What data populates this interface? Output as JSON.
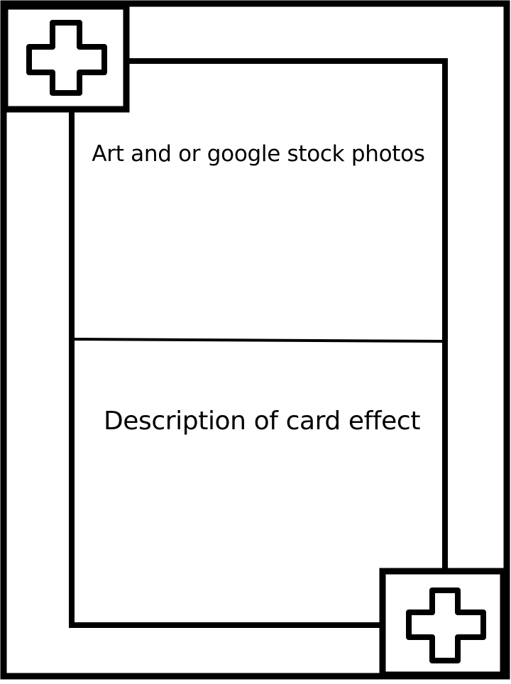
{
  "card": {
    "art_area_label": "Art and or google stock photos",
    "description_area_label": "Description of card effect",
    "stroke_color": "#000000",
    "background_color": "#ffffff",
    "corner_icon": "plus-cross-icon"
  }
}
